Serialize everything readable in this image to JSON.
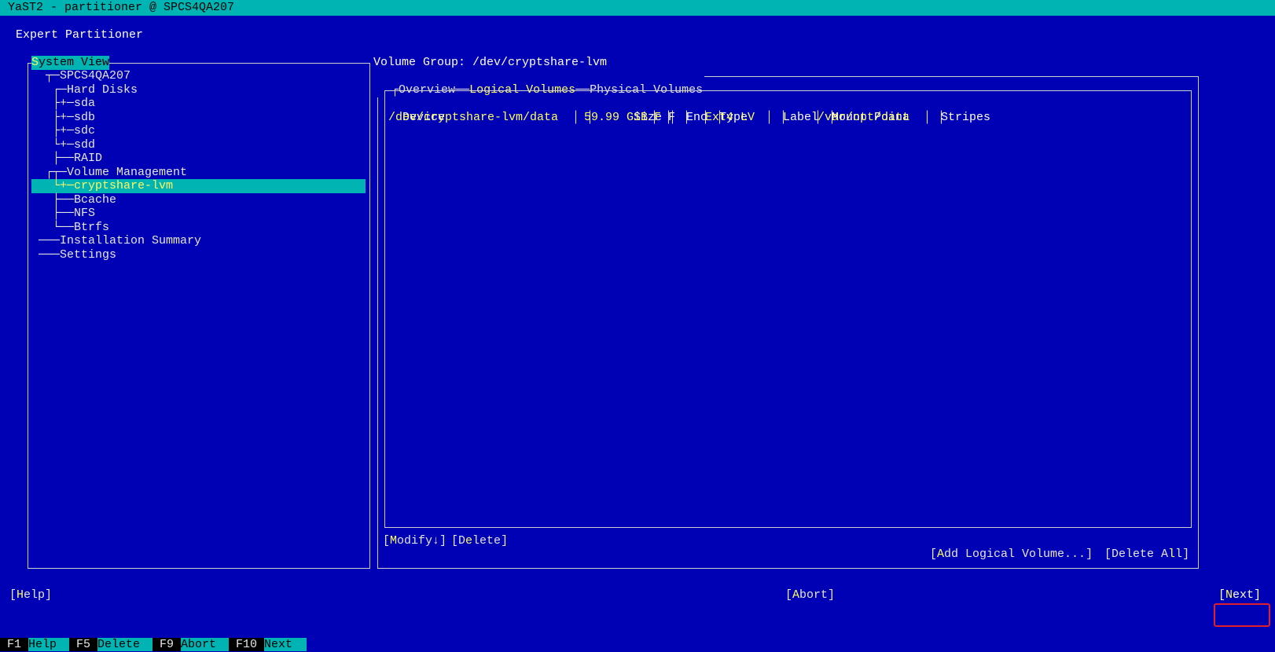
{
  "window": {
    "title": "YaST2 - partitioner @ SPCS4QA207"
  },
  "dialog": {
    "title": "Expert Partitioner"
  },
  "tree": {
    "frame_title_hotkey": "S",
    "frame_title_rest": "ystem View",
    "items": [
      {
        "prefix": "  ┬─",
        "label": "SPCS4QA207"
      },
      {
        "prefix": "   ┌─",
        "label": "Hard Disks"
      },
      {
        "prefix": "   ├+─",
        "label": "sda"
      },
      {
        "prefix": "   ├+─",
        "label": "sdb"
      },
      {
        "prefix": "   ├+─",
        "label": "sdc"
      },
      {
        "prefix": "   └+─",
        "label": "sdd"
      },
      {
        "prefix": "   ├──",
        "label": "RAID"
      },
      {
        "prefix": "  ┌┬─",
        "label": "Volume Management"
      },
      {
        "prefix": "   └+─",
        "label": "cryptshare-lvm",
        "selected": true
      },
      {
        "prefix": "   ├──",
        "label": "Bcache"
      },
      {
        "prefix": "   ├──",
        "label": "NFS"
      },
      {
        "prefix": "   └──",
        "label": "Btrfs"
      },
      {
        "prefix": " ───",
        "label": "Installation Summary"
      },
      {
        "prefix": " ───",
        "label": "Settings"
      }
    ]
  },
  "panel": {
    "heading": "Volume Group: /dev/cryptshare-lvm",
    "tabs": [
      {
        "label": "Overview"
      },
      {
        "label": "Logical Volumes",
        "active": true
      },
      {
        "label": "Physical Volumes"
      }
    ],
    "table": {
      "columns": [
        "Device",
        "Size",
        "F",
        "Enc",
        "Type",
        "Label",
        "Mount Point",
        "Stripes"
      ],
      "rows": [
        [
          "/dev/cryptshare-lvm/data",
          "59.99 GiB",
          "F",
          "",
          "Ext4 LV",
          "",
          "/var/opt/data",
          ""
        ]
      ]
    },
    "buttons": {
      "modify": {
        "hotkey": "M",
        "rest": "odify↓"
      },
      "delete": {
        "prefix": "D",
        "hotkey": "e",
        "rest": "lete"
      },
      "add_lv": {
        "hotkey": "A",
        "rest": "dd Logical Volume..."
      },
      "delete_all": {
        "prefix": "Delete A",
        "hotkey": "l",
        "rest": "l"
      }
    }
  },
  "footer": {
    "help": {
      "hotkey": "H",
      "rest": "elp"
    },
    "abort": {
      "hotkey": "A",
      "rest": "bort"
    },
    "next": {
      "hotkey": "N",
      "rest": "ext"
    }
  },
  "fkeys": [
    {
      "key": "F1",
      "label": "Help"
    },
    {
      "key": "F5",
      "label": "Delete"
    },
    {
      "key": "F9",
      "label": "Abort"
    },
    {
      "key": "F10",
      "label": "Next"
    }
  ]
}
